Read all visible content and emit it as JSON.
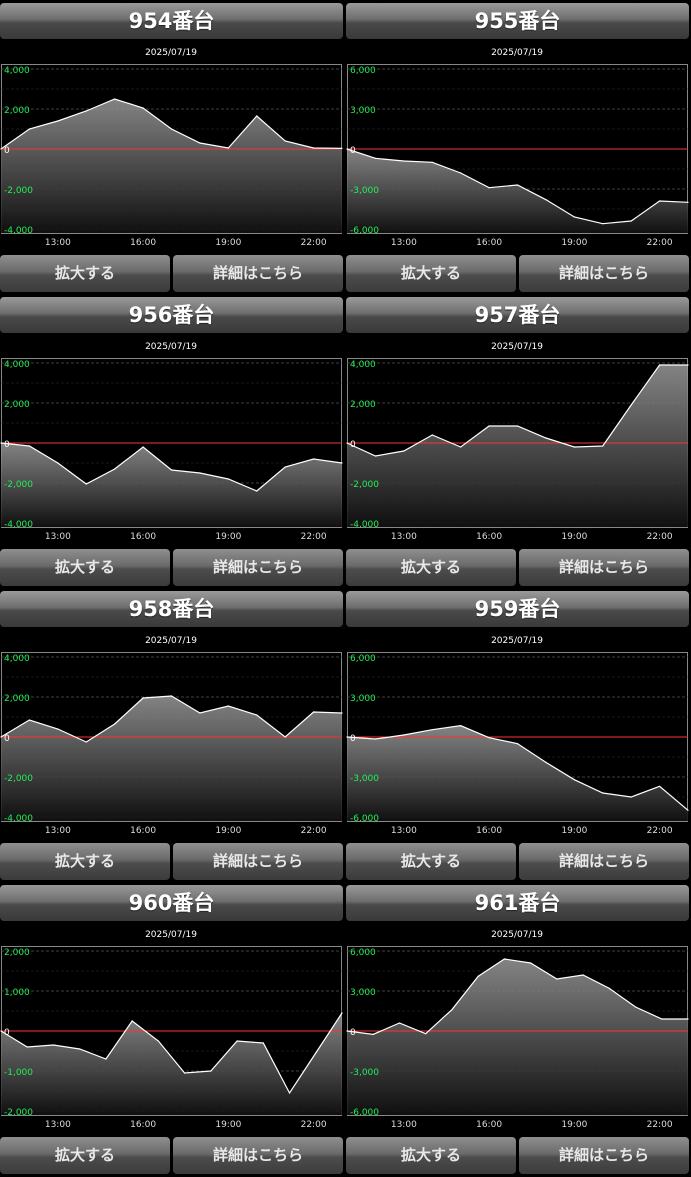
{
  "buttons": {
    "zoom": "拡大する",
    "detail": "詳細はこちら"
  },
  "colors": {
    "tick": "#22ee55",
    "zero_line": "#ff3333",
    "line": "#ffffff",
    "grid": "#555555"
  },
  "chart_data": [
    {
      "type": "area",
      "title": "954番台",
      "subtitle": "2025/07/19",
      "x": [
        "11:00",
        "12:00",
        "13:00",
        "14:00",
        "15:00",
        "16:00",
        "17:00",
        "18:00",
        "19:00",
        "20:00",
        "21:00",
        "22:00",
        "23:00"
      ],
      "x_ticks": [
        "13:00",
        "16:00",
        "19:00",
        "22:00"
      ],
      "y_ticks": [
        "4,000",
        "2,000",
        "0",
        "-2,000",
        "-4,000"
      ],
      "ylim": [
        -4000,
        4000
      ],
      "values": [
        0,
        1000,
        1400,
        1900,
        2500,
        2050,
        1000,
        300,
        50,
        1650,
        400,
        50,
        30
      ]
    },
    {
      "type": "area",
      "title": "955番台",
      "subtitle": "2025/07/19",
      "x": [
        "11:00",
        "12:00",
        "13:00",
        "14:00",
        "15:00",
        "16:00",
        "17:00",
        "18:00",
        "19:00",
        "20:00",
        "21:00",
        "22:00",
        "23:00"
      ],
      "x_ticks": [
        "13:00",
        "16:00",
        "19:00",
        "22:00"
      ],
      "y_ticks": [
        "6,000",
        "3,000",
        "0",
        "-3,000",
        "-6,000"
      ],
      "ylim": [
        -6000,
        6000
      ],
      "values": [
        0,
        -700,
        -900,
        -1000,
        -1800,
        -2900,
        -2700,
        -3800,
        -5100,
        -5600,
        -5400,
        -3900,
        -4000
      ]
    },
    {
      "type": "area",
      "title": "956番台",
      "subtitle": "2025/07/19",
      "x": [
        "11:00",
        "12:00",
        "13:00",
        "14:00",
        "15:00",
        "16:00",
        "17:00",
        "18:00",
        "19:00",
        "20:00",
        "21:00",
        "22:00",
        "23:00"
      ],
      "x_ticks": [
        "13:00",
        "16:00",
        "19:00",
        "22:00"
      ],
      "y_ticks": [
        "4,000",
        "2,000",
        "0",
        "-2,000",
        "-4,000"
      ],
      "ylim": [
        -4000,
        4000
      ],
      "values": [
        0,
        -150,
        -1000,
        -2050,
        -1300,
        -200,
        -1350,
        -1500,
        -1800,
        -2400,
        -1200,
        -800,
        -1000
      ]
    },
    {
      "type": "area",
      "title": "957番台",
      "subtitle": "2025/07/19",
      "x": [
        "11:00",
        "12:00",
        "13:00",
        "14:00",
        "15:00",
        "16:00",
        "17:00",
        "18:00",
        "19:00",
        "20:00",
        "21:00",
        "22:00",
        "23:00"
      ],
      "x_ticks": [
        "13:00",
        "16:00",
        "19:00",
        "22:00"
      ],
      "y_ticks": [
        "4,000",
        "2,000",
        "0",
        "-2,000",
        "-4,000"
      ],
      "ylim": [
        -4000,
        4000
      ],
      "values": [
        0,
        -650,
        -400,
        400,
        -200,
        850,
        850,
        250,
        -200,
        -150,
        1900,
        3900,
        3900
      ]
    },
    {
      "type": "area",
      "title": "958番台",
      "subtitle": "2025/07/19",
      "x": [
        "11:00",
        "12:00",
        "13:00",
        "14:00",
        "15:00",
        "16:00",
        "17:00",
        "18:00",
        "19:00",
        "20:00",
        "21:00",
        "22:00",
        "23:00"
      ],
      "x_ticks": [
        "13:00",
        "16:00",
        "19:00",
        "22:00"
      ],
      "y_ticks": [
        "4,000",
        "2,000",
        "0",
        "-2,000",
        "-4,000"
      ],
      "ylim": [
        -4000,
        4000
      ],
      "values": [
        0,
        850,
        400,
        -250,
        650,
        1950,
        2050,
        1200,
        1550,
        1100,
        0,
        1250,
        1200
      ]
    },
    {
      "type": "area",
      "title": "959番台",
      "subtitle": "2025/07/19",
      "x": [
        "11:00",
        "12:00",
        "13:00",
        "14:00",
        "15:00",
        "16:00",
        "17:00",
        "18:00",
        "19:00",
        "20:00",
        "21:00",
        "22:00",
        "23:00"
      ],
      "x_ticks": [
        "13:00",
        "16:00",
        "19:00",
        "22:00"
      ],
      "y_ticks": [
        "6,000",
        "3,000",
        "0",
        "-3,000",
        "-6,000"
      ],
      "ylim": [
        -6000,
        6000
      ],
      "values": [
        0,
        -150,
        150,
        550,
        850,
        -50,
        -500,
        -1900,
        -3200,
        -4200,
        -4500,
        -3700,
        -5500
      ]
    },
    {
      "type": "area",
      "title": "960番台",
      "subtitle": "2025/07/19",
      "x": [
        "11:00",
        "12:00",
        "13:00",
        "14:00",
        "15:00",
        "16:00",
        "17:00",
        "18:00",
        "19:00",
        "20:00",
        "21:00",
        "22:00",
        "23:00"
      ],
      "x_ticks": [
        "13:00",
        "16:00",
        "19:00",
        "22:00"
      ],
      "y_ticks": [
        "2,000",
        "1,000",
        "0",
        "-1,000",
        "-2,000"
      ],
      "ylim": [
        -2000,
        2000
      ],
      "values": [
        0,
        -400,
        -350,
        -450,
        -700,
        250,
        -250,
        -1050,
        -1000,
        -250,
        -300,
        -1550,
        -550,
        450
      ]
    },
    {
      "type": "area",
      "title": "961番台",
      "subtitle": "2025/07/19",
      "x": [
        "11:00",
        "12:00",
        "13:00",
        "14:00",
        "15:00",
        "16:00",
        "17:00",
        "18:00",
        "19:00",
        "20:00",
        "21:00",
        "22:00",
        "23:00"
      ],
      "x_ticks": [
        "13:00",
        "16:00",
        "19:00",
        "22:00"
      ],
      "y_ticks": [
        "6,000",
        "3,000",
        "0",
        "-3,000",
        "-6,000"
      ],
      "ylim": [
        -6000,
        6000
      ],
      "values": [
        0,
        -250,
        600,
        -200,
        1600,
        4100,
        5400,
        5100,
        3900,
        4200,
        3200,
        1800,
        900,
        900
      ]
    }
  ]
}
